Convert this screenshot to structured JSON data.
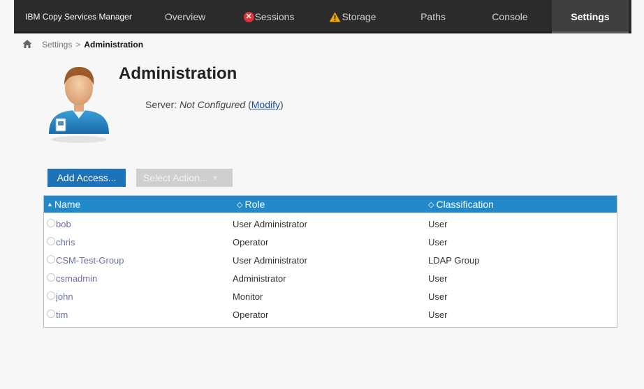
{
  "nav": {
    "brand": "IBM Copy Services Manager",
    "items": [
      {
        "label": "Overview"
      },
      {
        "label": "Sessions",
        "icon": "error-icon"
      },
      {
        "label": "Storage",
        "icon": "warning-icon"
      },
      {
        "label": "Paths"
      },
      {
        "label": "Console"
      },
      {
        "label": "Settings",
        "active": true
      }
    ]
  },
  "breadcrumb": {
    "parent": "Settings",
    "separator": ">",
    "current": "Administration"
  },
  "page": {
    "title": "Administration",
    "server_label": "Server:",
    "server_value": "Not Configured",
    "modify_open": "(",
    "modify_link": "Modify",
    "modify_close": ")"
  },
  "actions": {
    "add_access": "Add Access...",
    "select_action": "Select Action...",
    "select_enabled": false
  },
  "table": {
    "columns": [
      "Name",
      "Role",
      "Classification"
    ],
    "rows": [
      {
        "name": "bob",
        "role": "User Administrator",
        "classification": "User"
      },
      {
        "name": "chris",
        "role": "Operator",
        "classification": "User"
      },
      {
        "name": "CSM-Test-Group",
        "role": "User Administrator",
        "classification": "LDAP Group"
      },
      {
        "name": "csmadmin",
        "role": "Administrator",
        "classification": "User"
      },
      {
        "name": "john",
        "role": "Monitor",
        "classification": "User"
      },
      {
        "name": "tim",
        "role": "Operator",
        "classification": "User"
      }
    ]
  },
  "colors": {
    "nav_bg": "#2b2b2b",
    "accent": "#2189c8",
    "primary_button": "#1d72b8",
    "link": "#1d4ea0",
    "error": "#e0303a",
    "warning": "#f0a800"
  }
}
